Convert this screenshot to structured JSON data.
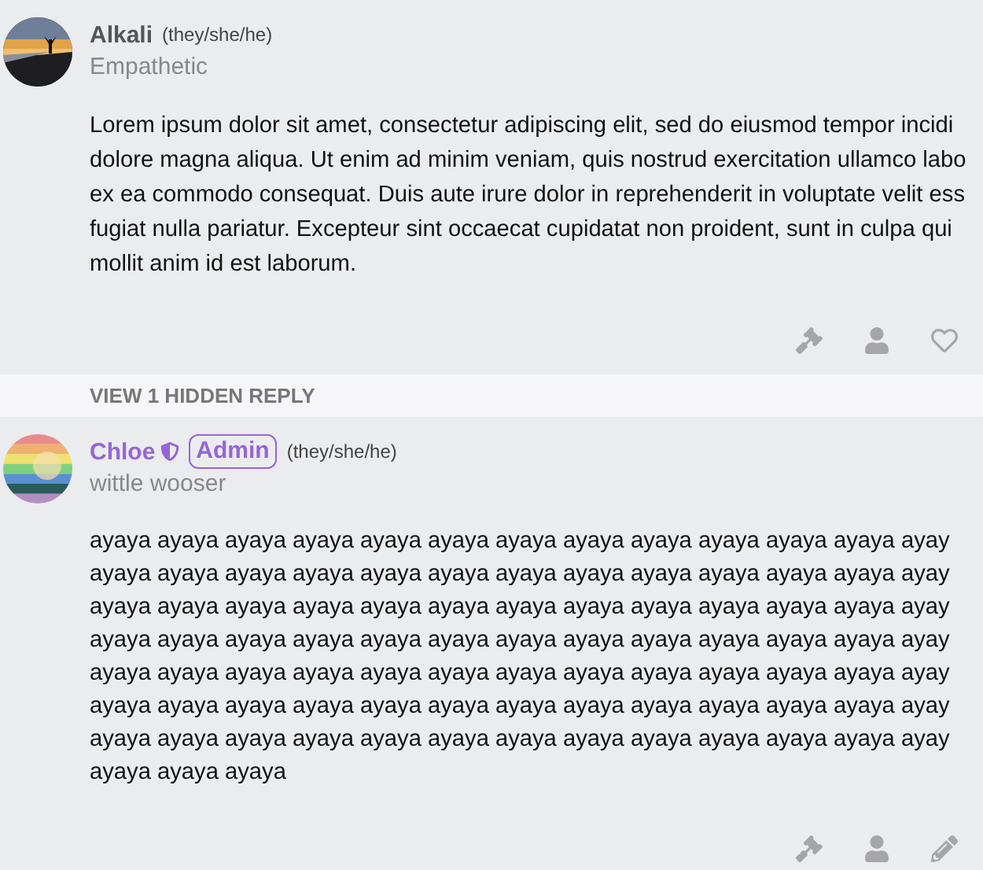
{
  "comments": [
    {
      "kind": "member",
      "author": "Alkali",
      "pronouns": "(they/she/he)",
      "subtitle": "Empathetic",
      "body_lines": [
        "Lorem ipsum dolor sit amet, consectetur adipiscing elit, sed do eiusmod tempor incidi",
        "dolore magna aliqua. Ut enim ad minim veniam, quis nostrud exercitation ullamco labo",
        "ex ea commodo consequat. Duis aute irure dolor in reprehenderit in voluptate velit ess",
        "fugiat nulla pariatur. Excepteur sint occaecat cupidatat non proident, sunt in culpa qui",
        "mollit anim id est laborum."
      ],
      "actions": [
        {
          "kind": "ban"
        },
        {
          "kind": "profile"
        },
        {
          "kind": "like"
        }
      ],
      "replies_toggle": "VIEW 1 HIDDEN REPLY"
    },
    {
      "kind": "admin",
      "author": "Chloe",
      "badge": "Admin",
      "pronouns": "(they/she/he)",
      "subtitle": "wittle wooser",
      "body_lines": [
        "ayaya ayaya ayaya ayaya ayaya ayaya ayaya ayaya ayaya ayaya ayaya ayaya ayay",
        "ayaya ayaya ayaya ayaya ayaya ayaya ayaya ayaya ayaya ayaya ayaya ayaya ayay",
        "ayaya ayaya ayaya ayaya ayaya ayaya ayaya ayaya ayaya ayaya ayaya ayaya ayay",
        "ayaya ayaya ayaya ayaya ayaya ayaya ayaya ayaya ayaya ayaya ayaya ayaya ayay",
        "ayaya ayaya ayaya ayaya ayaya ayaya ayaya ayaya ayaya ayaya ayaya ayaya ayay",
        "ayaya ayaya ayaya ayaya ayaya ayaya ayaya ayaya ayaya ayaya ayaya ayaya ayay",
        "ayaya ayaya ayaya ayaya ayaya ayaya ayaya ayaya ayaya ayaya ayaya ayaya ayay",
        "ayaya ayaya ayaya"
      ],
      "actions": [
        {
          "kind": "ban"
        },
        {
          "kind": "profile"
        },
        {
          "kind": "edit"
        }
      ]
    }
  ]
}
